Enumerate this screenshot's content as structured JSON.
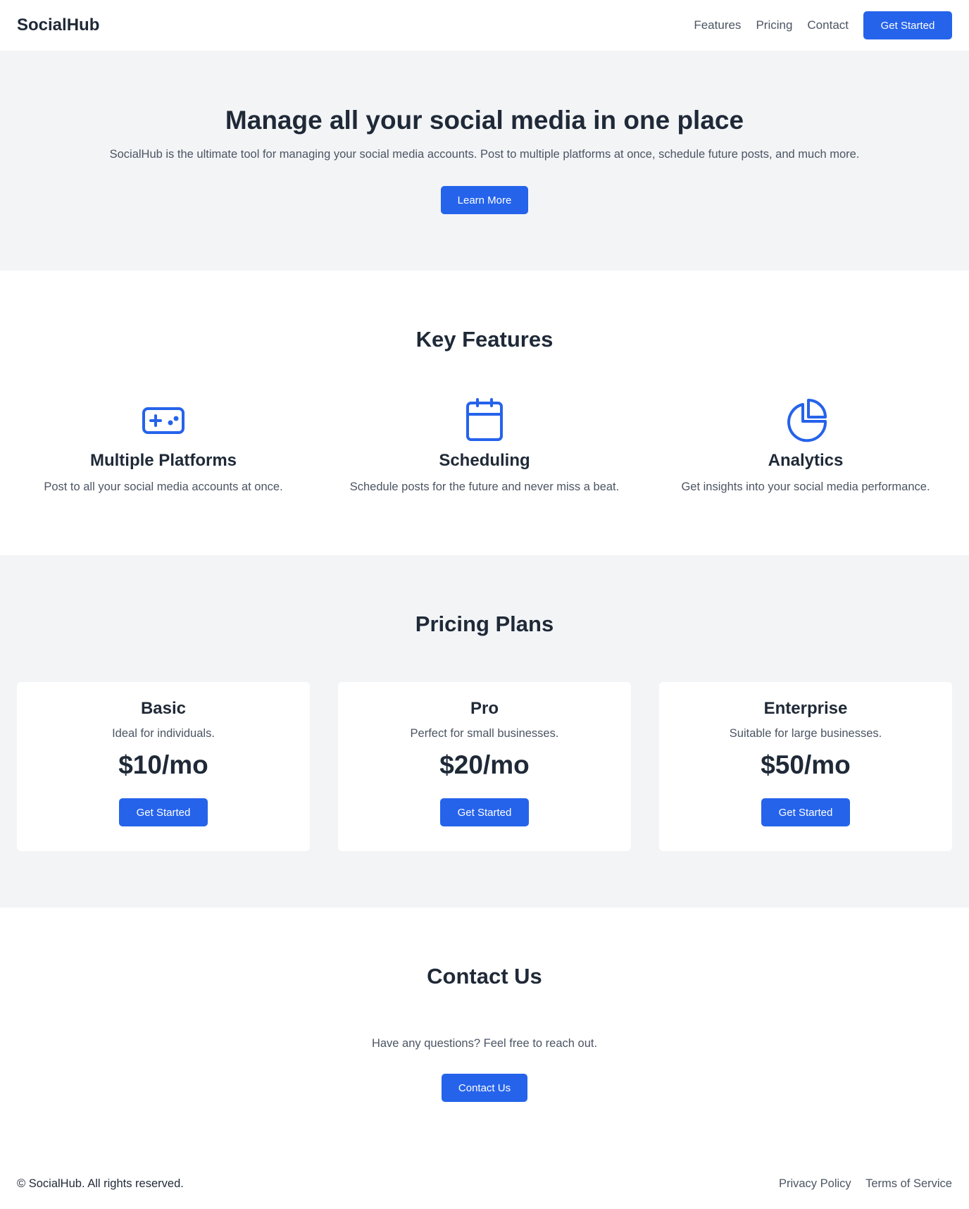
{
  "header": {
    "brand": "SocialHub",
    "nav": [
      "Features",
      "Pricing",
      "Contact"
    ],
    "cta": "Get Started"
  },
  "hero": {
    "title": "Manage all your social media in one place",
    "subtitle": "SocialHub is the ultimate tool for managing your social media accounts. Post to multiple platforms at once, schedule future posts, and much more.",
    "button": "Learn More"
  },
  "features": {
    "title": "Key Features",
    "items": [
      {
        "icon": "gamepad-icon",
        "title": "Multiple Platforms",
        "desc": "Post to all your social media accounts at once."
      },
      {
        "icon": "calendar-icon",
        "title": "Scheduling",
        "desc": "Schedule posts for the future and never miss a beat."
      },
      {
        "icon": "pie-chart-icon",
        "title": "Analytics",
        "desc": "Get insights into your social media performance."
      }
    ]
  },
  "pricing": {
    "title": "Pricing Plans",
    "plans": [
      {
        "name": "Basic",
        "desc": "Ideal for individuals.",
        "price": "$10/mo",
        "button": "Get Started"
      },
      {
        "name": "Pro",
        "desc": "Perfect for small businesses.",
        "price": "$20/mo",
        "button": "Get Started"
      },
      {
        "name": "Enterprise",
        "desc": "Suitable for large businesses.",
        "price": "$50/mo",
        "button": "Get Started"
      }
    ]
  },
  "contact": {
    "title": "Contact Us",
    "text": "Have any questions? Feel free to reach out.",
    "button": "Contact Us"
  },
  "footer": {
    "copyright": "© SocialHub. All rights reserved.",
    "links": [
      "Privacy Policy",
      "Terms of Service"
    ]
  },
  "colors": {
    "accent": "#2563eb",
    "heading": "#1f2937",
    "body_text": "#4b5563",
    "section_bg": "#f3f4f6"
  }
}
